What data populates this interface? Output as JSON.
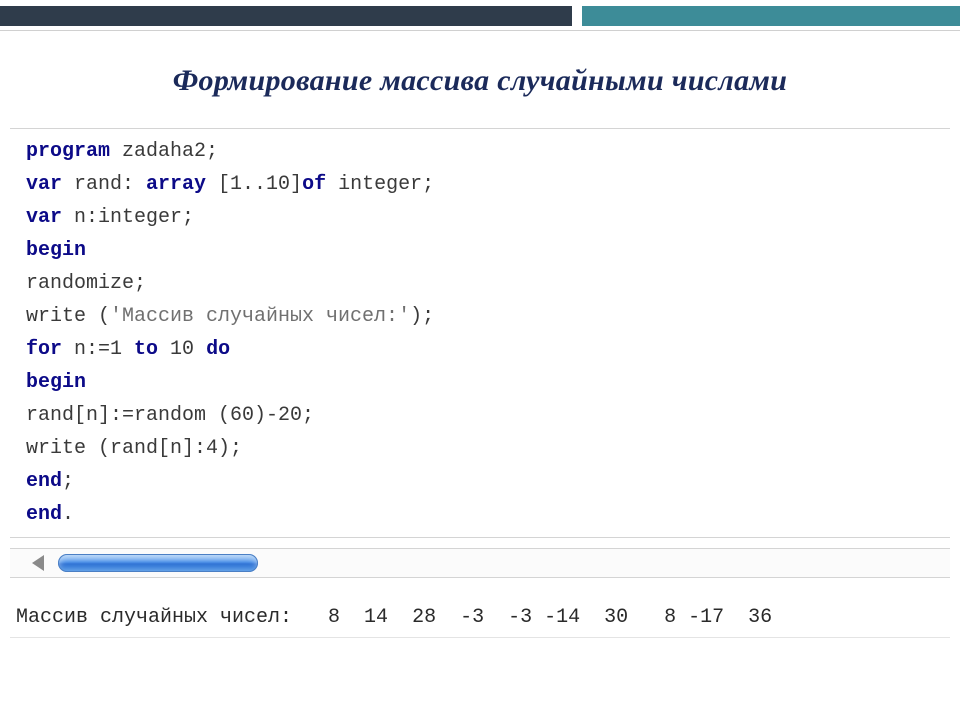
{
  "title": "Формирование массива случайными числами",
  "code": {
    "lines": [
      {
        "tokens": [
          {
            "t": "program ",
            "c": "kw"
          },
          {
            "t": "zadaha2;",
            "c": "nm"
          }
        ]
      },
      {
        "tokens": [
          {
            "t": "var ",
            "c": "kw"
          },
          {
            "t": "rand: ",
            "c": "nm"
          },
          {
            "t": "array ",
            "c": "kw"
          },
          {
            "t": "[1..10]",
            "c": "nm"
          },
          {
            "t": "of ",
            "c": "kw"
          },
          {
            "t": "integer;",
            "c": "nm"
          }
        ]
      },
      {
        "tokens": [
          {
            "t": "var ",
            "c": "kw"
          },
          {
            "t": "n:integer;",
            "c": "nm"
          }
        ]
      },
      {
        "tokens": [
          {
            "t": "begin",
            "c": "kw"
          }
        ]
      },
      {
        "tokens": [
          {
            "t": "randomize;",
            "c": "nm"
          }
        ]
      },
      {
        "tokens": [
          {
            "t": "write (",
            "c": "nm"
          },
          {
            "t": "'Массив случайных чисел:'",
            "c": "st"
          },
          {
            "t": ");",
            "c": "nm"
          }
        ]
      },
      {
        "tokens": [
          {
            "t": "for ",
            "c": "kw"
          },
          {
            "t": "n:=1 ",
            "c": "nm"
          },
          {
            "t": "to ",
            "c": "kw"
          },
          {
            "t": "10 ",
            "c": "nm"
          },
          {
            "t": "do",
            "c": "kw"
          }
        ]
      },
      {
        "tokens": [
          {
            "t": "begin",
            "c": "kw"
          }
        ]
      },
      {
        "tokens": [
          {
            "t": "rand[n]:=random (60)-20;",
            "c": "nm"
          }
        ]
      },
      {
        "tokens": [
          {
            "t": "write (rand[n]:4);",
            "c": "nm"
          }
        ]
      },
      {
        "tokens": [
          {
            "t": "end",
            "c": "kw"
          },
          {
            "t": ";",
            "c": "nm"
          }
        ]
      },
      {
        "tokens": [
          {
            "t": "end",
            "c": "kw"
          },
          {
            "t": ".",
            "c": "nm"
          }
        ]
      }
    ]
  },
  "output": {
    "label": "Массив случайных чисел:",
    "values": [
      8,
      14,
      28,
      -3,
      -3,
      -14,
      30,
      8,
      -17,
      36
    ],
    "rendered": "Массив случайных чисел:   8  14  28  -3  -3 -14  30   8 -17  36"
  }
}
